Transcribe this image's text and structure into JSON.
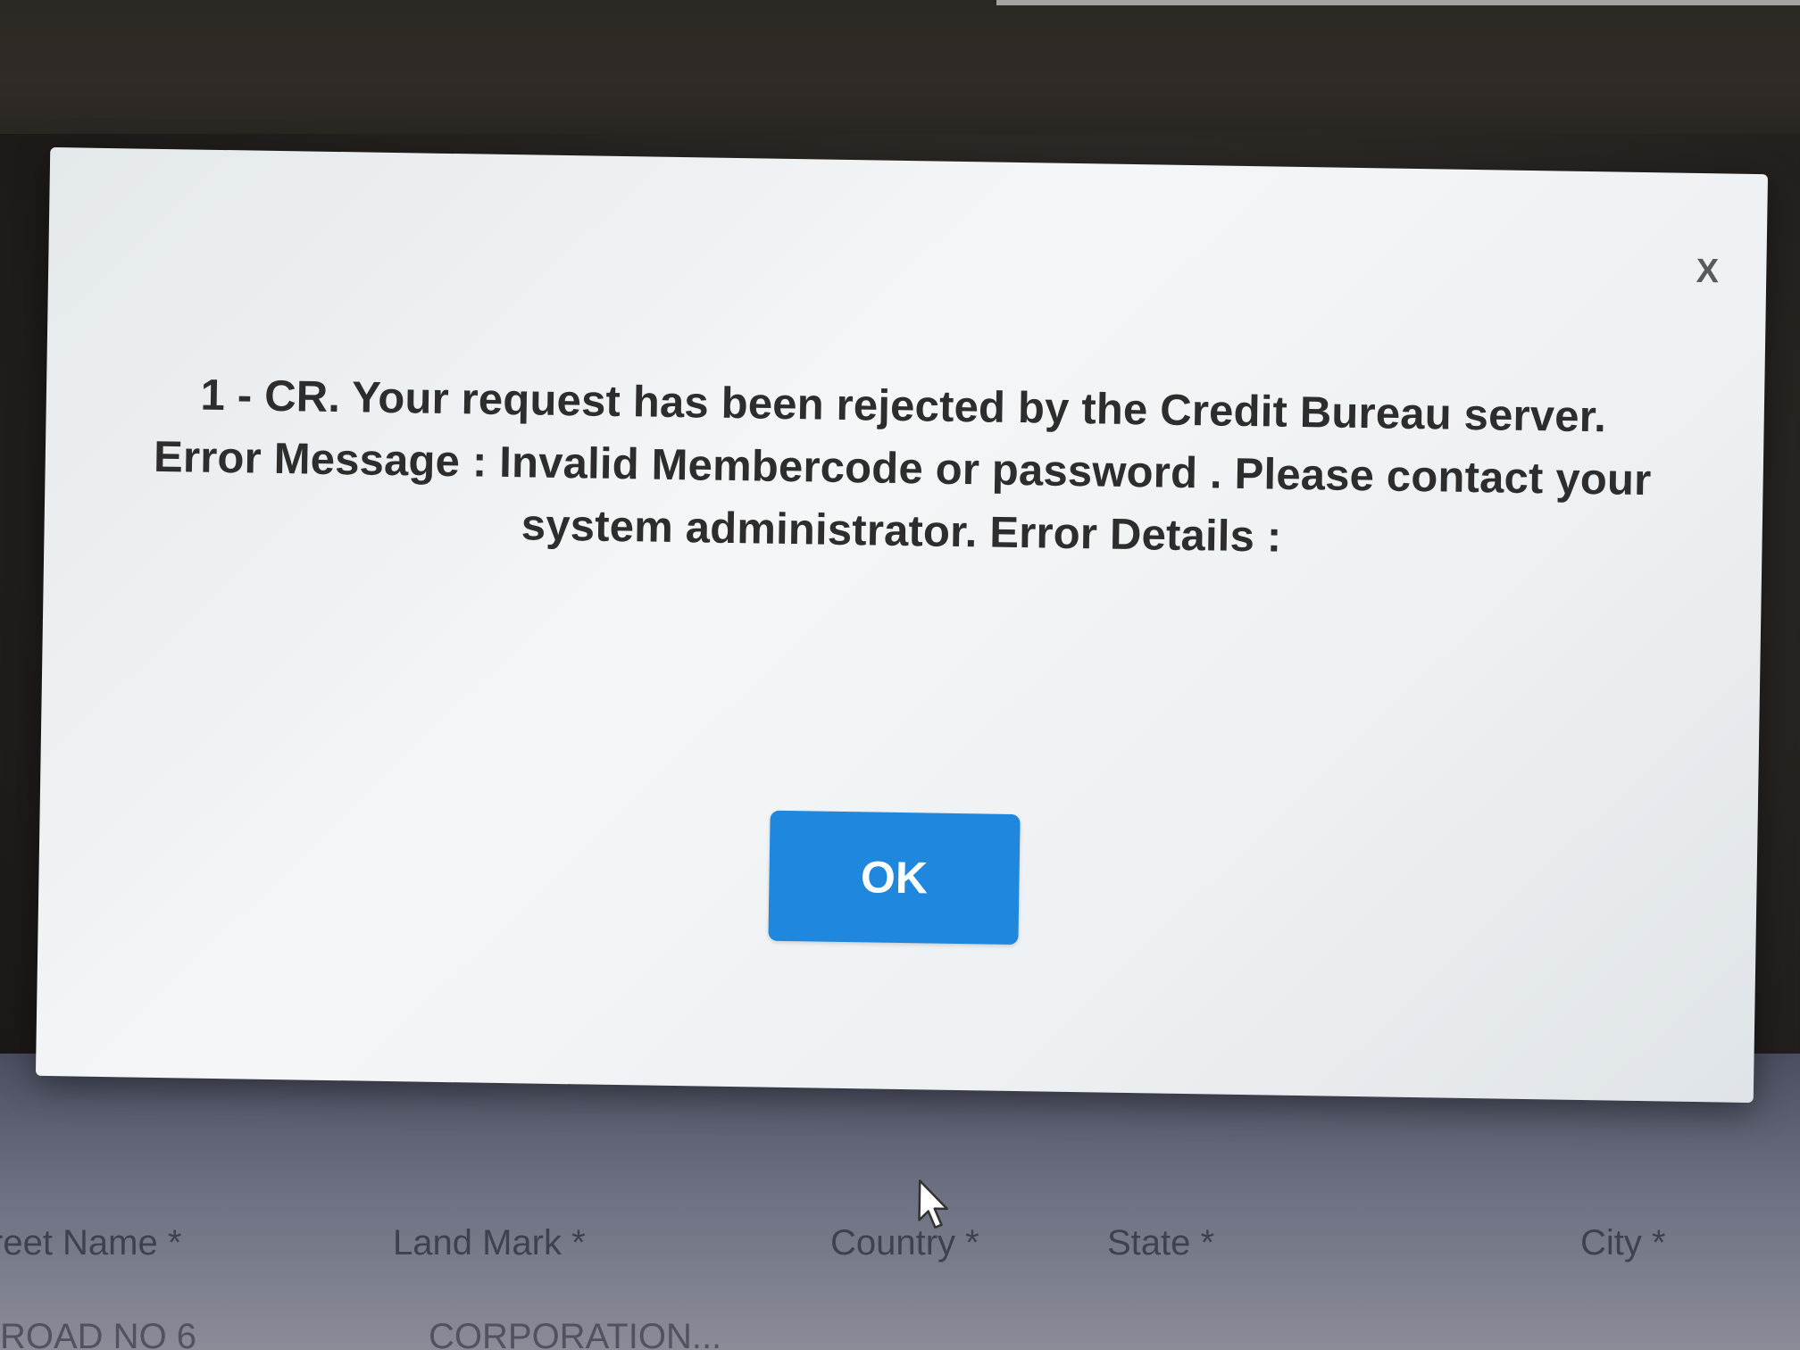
{
  "dialog": {
    "close_label": "X",
    "message": "1 - CR. Your request has been rejected by the Credit Bureau server. Error Message : Invalid Membercode or password . Please contact your system administrator. Error Details :",
    "ok_label": "OK",
    "colors": {
      "ok_button": "#1f87dd",
      "ok_text": "#ffffff",
      "message_text": "#2d2d2d"
    }
  },
  "background_form": {
    "labels": [
      "reet Name *",
      "Land Mark *",
      "Country *",
      "State *",
      "City *"
    ],
    "values": [
      "ROAD NO 6",
      "CORPORATION..."
    ]
  },
  "cursor": {
    "icon": "arrow-cursor-icon"
  }
}
